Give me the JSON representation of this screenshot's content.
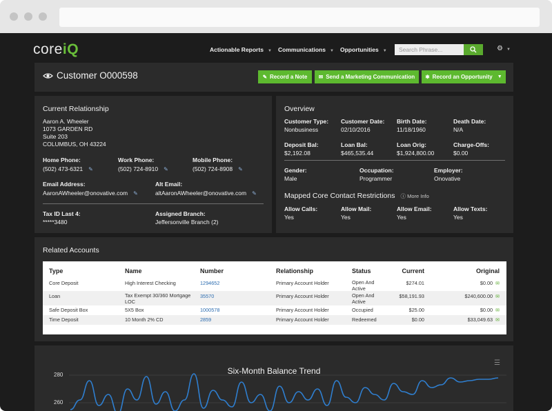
{
  "brand": {
    "logo_a": "core",
    "logo_b": "iQ"
  },
  "nav": {
    "items": [
      "Actionable Reports",
      "Communications",
      "Opportunities"
    ],
    "search_placeholder": "Search Phrase..."
  },
  "customer": {
    "title": "Customer O000598",
    "buttons": {
      "record_note": "Record a Note",
      "send_marketing": "Send a Marketing Communication",
      "record_opportunity": "Record an Opportunity"
    }
  },
  "relationship": {
    "title": "Current Relationship",
    "address": [
      "Aaron A. Wheeler",
      "1073 GARDEN RD",
      "Suite 203",
      "COLUMBUS, OH 43224"
    ],
    "home_phone_label": "Home Phone:",
    "home_phone": "(502) 473-6321",
    "work_phone_label": "Work Phone:",
    "work_phone": "(502) 724-8910",
    "mobile_phone_label": "Mobile Phone:",
    "mobile_phone": "(502) 724-8908",
    "email_label": "Email Address:",
    "email": "AaronAWheeler@onovative.com",
    "alt_email_label": "Alt Email:",
    "alt_email": "altAaronAWheeler@onovative.com",
    "taxid_label": "Tax ID Last 4:",
    "taxid": "*****3480",
    "branch_label": "Assigned Branch:",
    "branch": "Jeffersonville Branch (2)"
  },
  "overview": {
    "title": "Overview",
    "row1": [
      {
        "label": "Customer Type:",
        "value": "Nonbusiness"
      },
      {
        "label": "Customer Date:",
        "value": "02/10/2016"
      },
      {
        "label": "Birth Date:",
        "value": "11/18/1960"
      },
      {
        "label": "Death Date:",
        "value": "N/A"
      }
    ],
    "row2": [
      {
        "label": "Deposit Bal:",
        "value": "$2,192.08"
      },
      {
        "label": "Loan Bal:",
        "value": "$465,535.44"
      },
      {
        "label": "Loan Orig:",
        "value": "$1,924,800.00"
      },
      {
        "label": "Charge-Offs:",
        "value": "$0.00"
      }
    ],
    "row3": [
      {
        "label": "Gender:",
        "value": "Male"
      },
      {
        "label": "Occupation:",
        "value": "Programmer"
      },
      {
        "label": "Employer:",
        "value": "Onovative"
      }
    ],
    "restrictions_title": "Mapped Core Contact Restrictions",
    "more_info": "More Info",
    "row4": [
      {
        "label": "Allow Calls:",
        "value": "Yes"
      },
      {
        "label": "Allow Mail:",
        "value": "Yes"
      },
      {
        "label": "Allow Email:",
        "value": "Yes"
      },
      {
        "label": "Allow Texts:",
        "value": "Yes"
      }
    ]
  },
  "accounts": {
    "title": "Related Accounts",
    "columns": [
      "Type",
      "Name",
      "Number",
      "Relationship",
      "Status",
      "Current",
      "Original"
    ],
    "rows": [
      {
        "type": "Core Deposit",
        "name": "High Interest Checking",
        "number": "1294652",
        "relationship": "Primary Account Holder",
        "status": "Open And Active",
        "current": "$274.01",
        "original": "$0.00"
      },
      {
        "type": "Loan",
        "name": "Tax Exempt 30/360 Mortgage LOC",
        "number": "35570",
        "relationship": "Primary Account Holder",
        "status": "Open And Active",
        "current": "$58,191.93",
        "original": "$240,600.00"
      },
      {
        "type": "Safe Deposit Box",
        "name": "5X5 Box",
        "number": "1000578",
        "relationship": "Primary Account Holder",
        "status": "Occupied",
        "current": "$25.00",
        "original": "$0.00"
      },
      {
        "type": "Time Deposit",
        "name": "10 Month 2% CD",
        "number": "2859",
        "relationship": "Primary Account Holder",
        "status": "Redeemed",
        "current": "$0.00",
        "original": "$33,049.63"
      }
    ]
  },
  "trend": {
    "title": "Six-Month Balance Trend",
    "yticks": [
      "280",
      "260"
    ],
    "line_color": "#2f7fd0",
    "values": [
      255,
      262,
      276,
      258,
      266,
      252,
      270,
      262,
      279,
      259,
      268,
      254,
      262,
      281,
      256,
      269,
      262,
      257,
      275,
      260,
      266,
      254,
      272,
      260,
      268,
      262,
      270,
      258,
      276,
      264,
      260,
      271,
      266,
      262,
      274,
      268,
      266,
      276,
      271,
      273,
      278,
      275,
      276,
      277,
      277,
      278
    ]
  }
}
